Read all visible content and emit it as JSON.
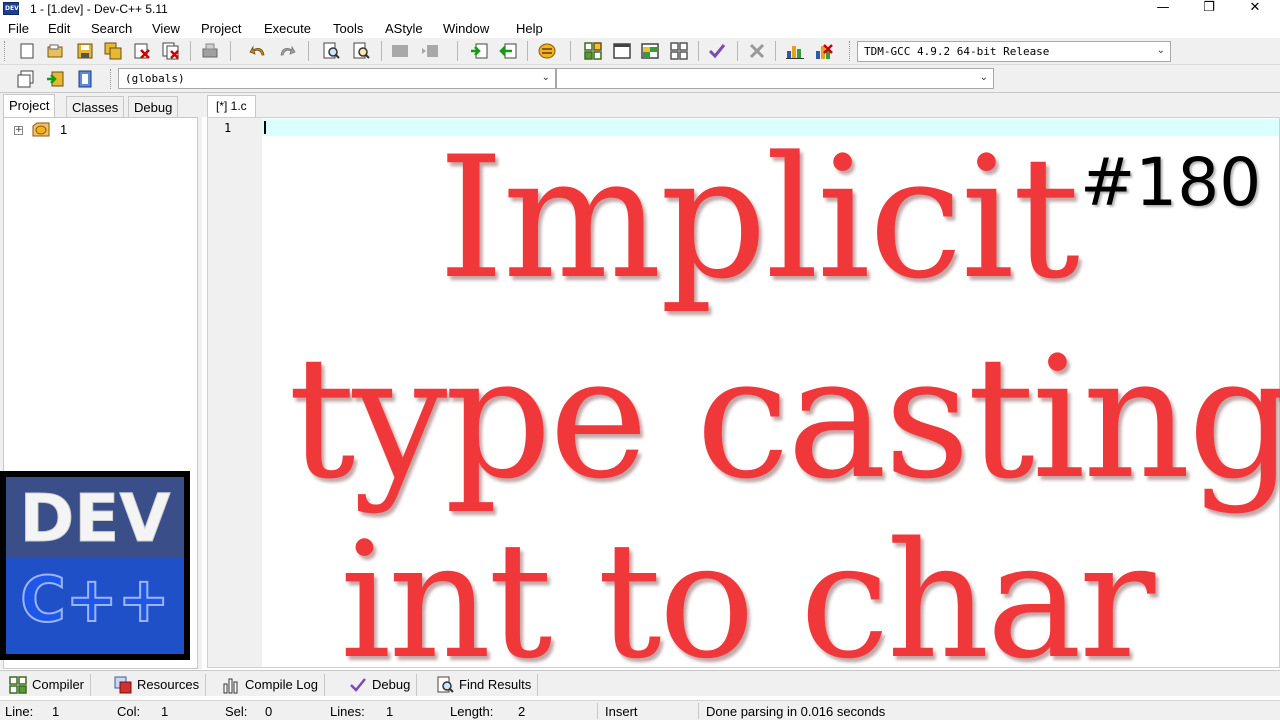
{
  "window": {
    "title": "1 - [1.dev] - Dev-C++ 5.11",
    "icon_text": "DEV",
    "minimize": "—",
    "maximize": "❐",
    "close": "✕"
  },
  "menu": [
    "File",
    "Edit",
    "Search",
    "View",
    "Project",
    "Execute",
    "Tools",
    "AStyle",
    "Window",
    "Help"
  ],
  "toolbar": {
    "compiler_select": "TDM-GCC 4.9.2 64-bit Release",
    "scope_select": "(globals)",
    "symbol_select": ""
  },
  "left_panel": {
    "tabs": [
      "Project",
      "Classes",
      "Debug"
    ],
    "active_tab": "Project",
    "tree_expander": "+",
    "tree_node_label": "1"
  },
  "logo": {
    "top_text": "DEV",
    "bottom_text": "C++"
  },
  "editor": {
    "tab_label": "[*] 1.c",
    "line_number": "1"
  },
  "overlay": {
    "line1": "Implicit",
    "line2": "type casting",
    "line3": "int to char",
    "number": "#180"
  },
  "bottom_tabs": [
    "Compiler",
    "Resources",
    "Compile Log",
    "Debug",
    "Find Results"
  ],
  "status": {
    "line_label": "Line:",
    "line_value": "1",
    "col_label": "Col:",
    "col_value": "1",
    "sel_label": "Sel:",
    "sel_value": "0",
    "lines_label": "Lines:",
    "lines_value": "1",
    "length_label": "Length:",
    "length_value": "2",
    "mode": "Insert",
    "message": "Done parsing in 0.016 seconds"
  },
  "colors": {
    "overlay_red": "#f0383a",
    "active_line": "#d9ffff",
    "logo_blue": "#1c3f8f"
  }
}
